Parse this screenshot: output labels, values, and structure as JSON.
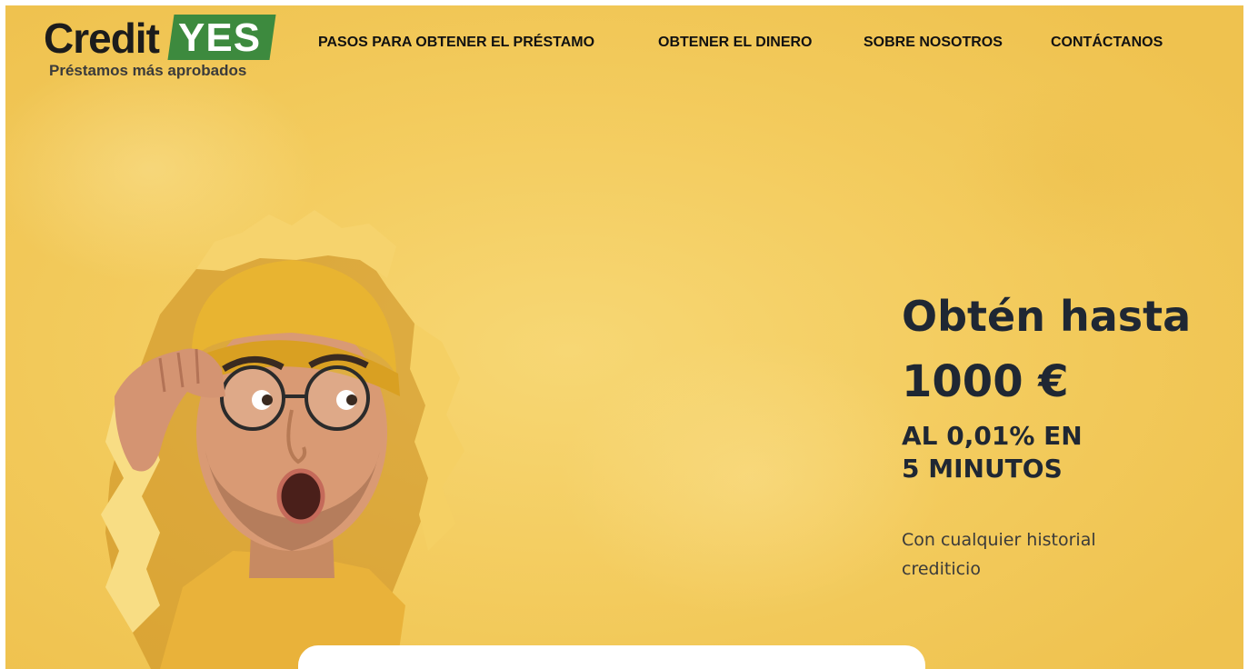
{
  "brand": {
    "name_part1": "Credit",
    "name_part2": "YES",
    "tagline": "Préstamos más aprobados",
    "accent_color": "#3d8a3e"
  },
  "nav": {
    "items": [
      {
        "label": "PASOS PARA OBTENER EL PRÉSTAMO"
      },
      {
        "label": "OBTENER EL DINERO"
      },
      {
        "label": "SOBRE NOSOTROS"
      },
      {
        "label": "CONTÁCTANOS"
      }
    ]
  },
  "hero": {
    "title": "Obtén hasta",
    "amount": "1000 €",
    "rate_line1": "AL  0,01% EN",
    "rate_line2": "5 MINUTOS",
    "subtitle": "Con cualquier historial crediticio",
    "background_color": "#f3cb5d",
    "image": "man-peeking-through-torn-yellow-paper"
  }
}
